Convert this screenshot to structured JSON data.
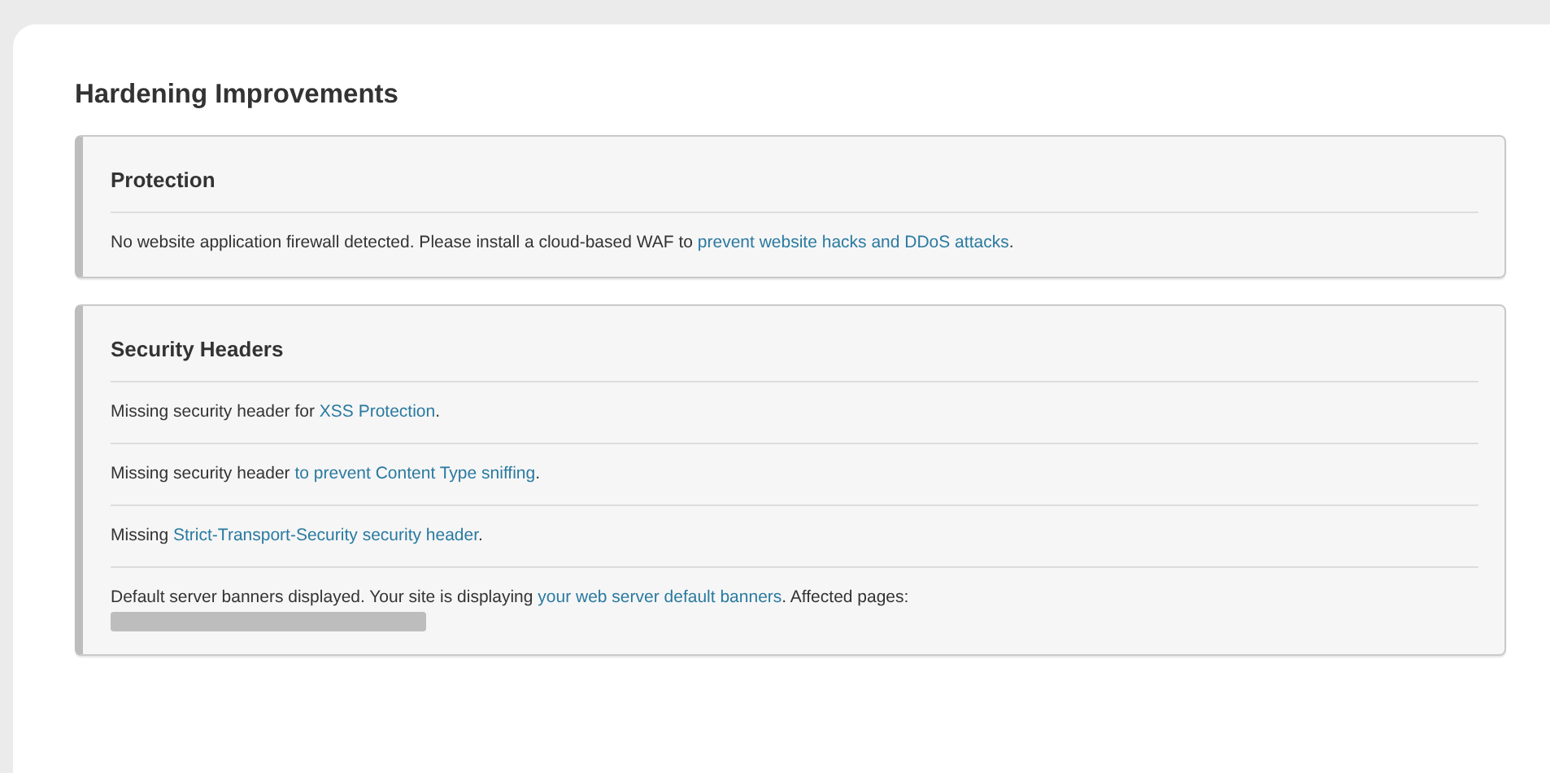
{
  "title": "Hardening Improvements",
  "panels": [
    {
      "heading": "Protection",
      "items": [
        {
          "before": "No website application firewall detected. Please install a cloud-based WAF to ",
          "link": "prevent website hacks and DDoS attacks",
          "after": ".",
          "redacted": false
        }
      ]
    },
    {
      "heading": "Security Headers",
      "items": [
        {
          "before": "Missing security header for ",
          "link": "XSS Protection",
          "after": ".",
          "redacted": false
        },
        {
          "before": "Missing security header ",
          "link": "to prevent Content Type sniffing",
          "after": ".",
          "redacted": false
        },
        {
          "before": "Missing ",
          "link": "Strict-Transport-Security security header",
          "after": ".",
          "redacted": false
        },
        {
          "before": "Default server banners displayed. Your site is displaying ",
          "link": "your web server default banners",
          "after": ". Affected pages:",
          "redacted": true
        }
      ]
    }
  ]
}
